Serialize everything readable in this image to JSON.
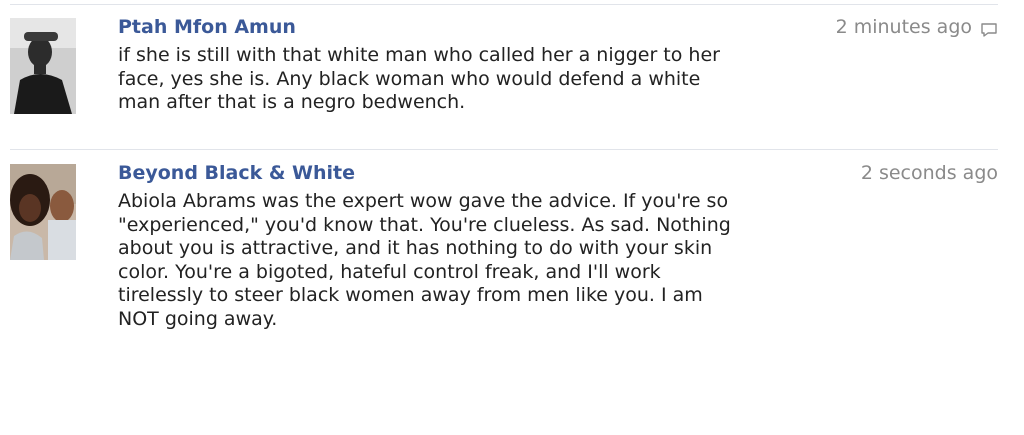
{
  "comments": [
    {
      "author": "Ptah Mfon Amun",
      "timestamp": "2 minutes ago",
      "text": "if she is still with that white man who called her a nigger to her\nface, yes she is. Any black woman who would defend a white\nman after that is a negro bedwench.",
      "avatar_icon": "avatar-icon",
      "show_reply_icon": true
    },
    {
      "author": "Beyond Black & White",
      "timestamp": "2 seconds ago",
      "text": "Abiola Abrams was the expert wow gave the advice. If you're so\n\"experienced,\" you'd know that. You're clueless. As sad. Nothing\nabout you is attractive, and it has nothing to do with your skin\ncolor. You're a bigoted, hateful control freak, and I'll work\ntirelessly to steer black women away from men like you. I am\nNOT going away.",
      "avatar_icon": "avatar-icon",
      "show_reply_icon": false
    }
  ],
  "colors": {
    "author_link": "#3b5998",
    "timestamp": "#8a8a8a",
    "text": "#222222",
    "divider": "#e1e4ea"
  }
}
